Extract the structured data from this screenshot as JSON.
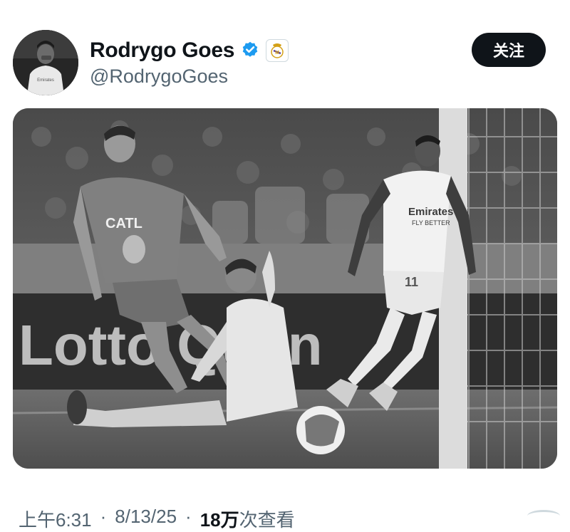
{
  "user": {
    "display_name": "Rodrygo Goes",
    "handle": "@RodrygoGoes",
    "verified_icon": "verified-badge-icon",
    "affiliation_icon": "real-madrid-crest-icon"
  },
  "actions": {
    "follow_label": "关注"
  },
  "media": {
    "board_text": "Lotto Quen",
    "shirt_text_left": "CATL",
    "shirt_text_right": "Emirates",
    "shirt_text_right_sub": "FLY BETTER",
    "shirt_number": "11"
  },
  "meta": {
    "time": "上午6:31",
    "date": "8/13/25",
    "views_count": "18万",
    "views_label": "次查看"
  },
  "colors": {
    "follow_bg": "#0f1419",
    "verified": "#1d9bf0",
    "secondary_text": "#536471"
  }
}
